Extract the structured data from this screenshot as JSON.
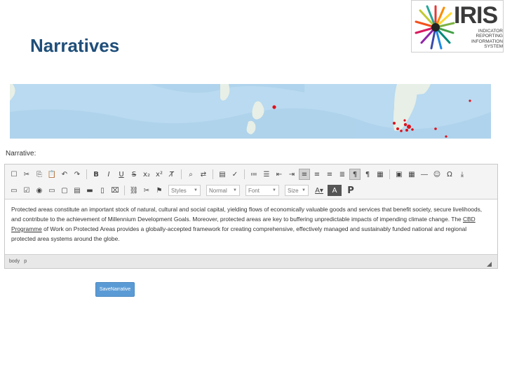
{
  "slide": {
    "title": "Narratives"
  },
  "logo": {
    "word": "IRIS",
    "subtitle_lines": [
      "INDICATOR",
      "REPORTING",
      "INFORMATION",
      "SYSTEM"
    ]
  },
  "narrative": {
    "label": "Narrative:"
  },
  "toolbar": {
    "styles_label": "Styles",
    "format_label": "Normal",
    "font_label": "Font",
    "size_label": "Size"
  },
  "editor": {
    "content_before_link": "Protected areas constitute an important stock of natural, cultural and social capital, yielding flows of economically valuable goods and services that benefit society, secure livelihoods, and contribute to the achievement of Millennium Development Goals. Moreover, protected areas are key to buffering unpredictable impacts of impending climate change. The ",
    "link_text": "CBD Programme",
    "content_after_link": " of Work on Protected Areas provides a globally-accepted framework for creating comprehensive, effectively managed and sustainably funded national and regional protected area systems around the globe.",
    "path": [
      "body",
      "p"
    ]
  },
  "save_button": {
    "label": "SaveNarrative"
  },
  "colors": {
    "title": "#1f4e79",
    "button": "#5b9bd5",
    "map_ocean": "#b9daf0",
    "map_land": "#e8efe6",
    "map_marker": "#e0101a"
  }
}
